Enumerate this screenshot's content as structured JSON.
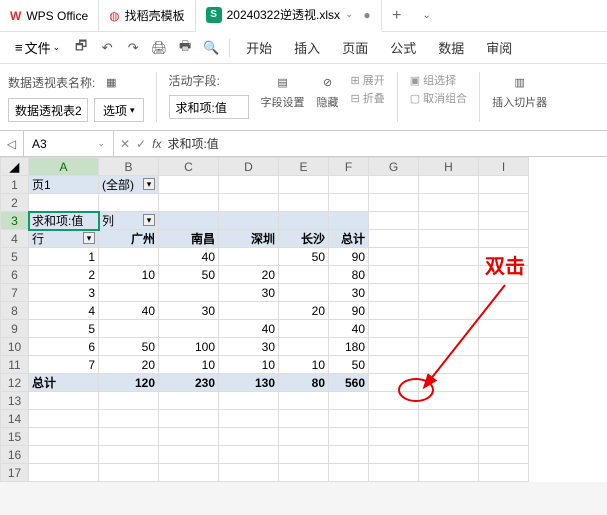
{
  "tabs": {
    "wps": "WPS Office",
    "template": "找稻壳模板",
    "file": "20240322逆透视.xlsx"
  },
  "menu": {
    "file": "文件",
    "start": "开始",
    "insert": "插入",
    "page": "页面",
    "formula": "公式",
    "data": "数据",
    "review": "审阅"
  },
  "ribbon": {
    "pivot_name_label": "数据透视表名称:",
    "pivot_name_value": "数据透视表2",
    "options": "选项",
    "active_field_label": "活动字段:",
    "active_field_value": "求和项:值",
    "field_settings": "字段设置",
    "hide": "隐藏",
    "expand": "展开",
    "collapse": "折叠",
    "group_select": "组选择",
    "ungroup": "取消组合",
    "slicer": "插入切片器"
  },
  "namebox": "A3",
  "formula": "求和项:值",
  "columns": [
    "A",
    "B",
    "C",
    "D",
    "E",
    "F",
    "G",
    "H",
    "I"
  ],
  "rows_h": [
    "1",
    "2",
    "3",
    "4",
    "5",
    "6",
    "7",
    "8",
    "9",
    "10",
    "11",
    "12",
    "13",
    "14",
    "15",
    "16",
    "17"
  ],
  "pivot": {
    "page_label": "页1",
    "page_val": "(全部)",
    "values_label": "求和项:值",
    "col_label": "列",
    "row_label": "行",
    "cols": [
      "广州",
      "南昌",
      "深圳",
      "长沙",
      "总计"
    ],
    "rows": [
      "1",
      "2",
      "3",
      "4",
      "5",
      "6",
      "7"
    ],
    "data": [
      [
        "",
        "",
        "40",
        "",
        "50",
        "90"
      ],
      [
        "",
        "10",
        "50",
        "20",
        "",
        "80"
      ],
      [
        "",
        "",
        "",
        "30",
        "",
        "30"
      ],
      [
        "",
        "40",
        "30",
        "",
        "20",
        "90"
      ],
      [
        "",
        "",
        "",
        "40",
        "",
        "40"
      ],
      [
        "",
        "50",
        "100",
        "30",
        "",
        "180"
      ],
      [
        "",
        "20",
        "10",
        "10",
        "10",
        "50"
      ]
    ],
    "totals_label": "总计",
    "totals": [
      "120",
      "230",
      "130",
      "80",
      "560"
    ]
  },
  "annotation": "双击"
}
